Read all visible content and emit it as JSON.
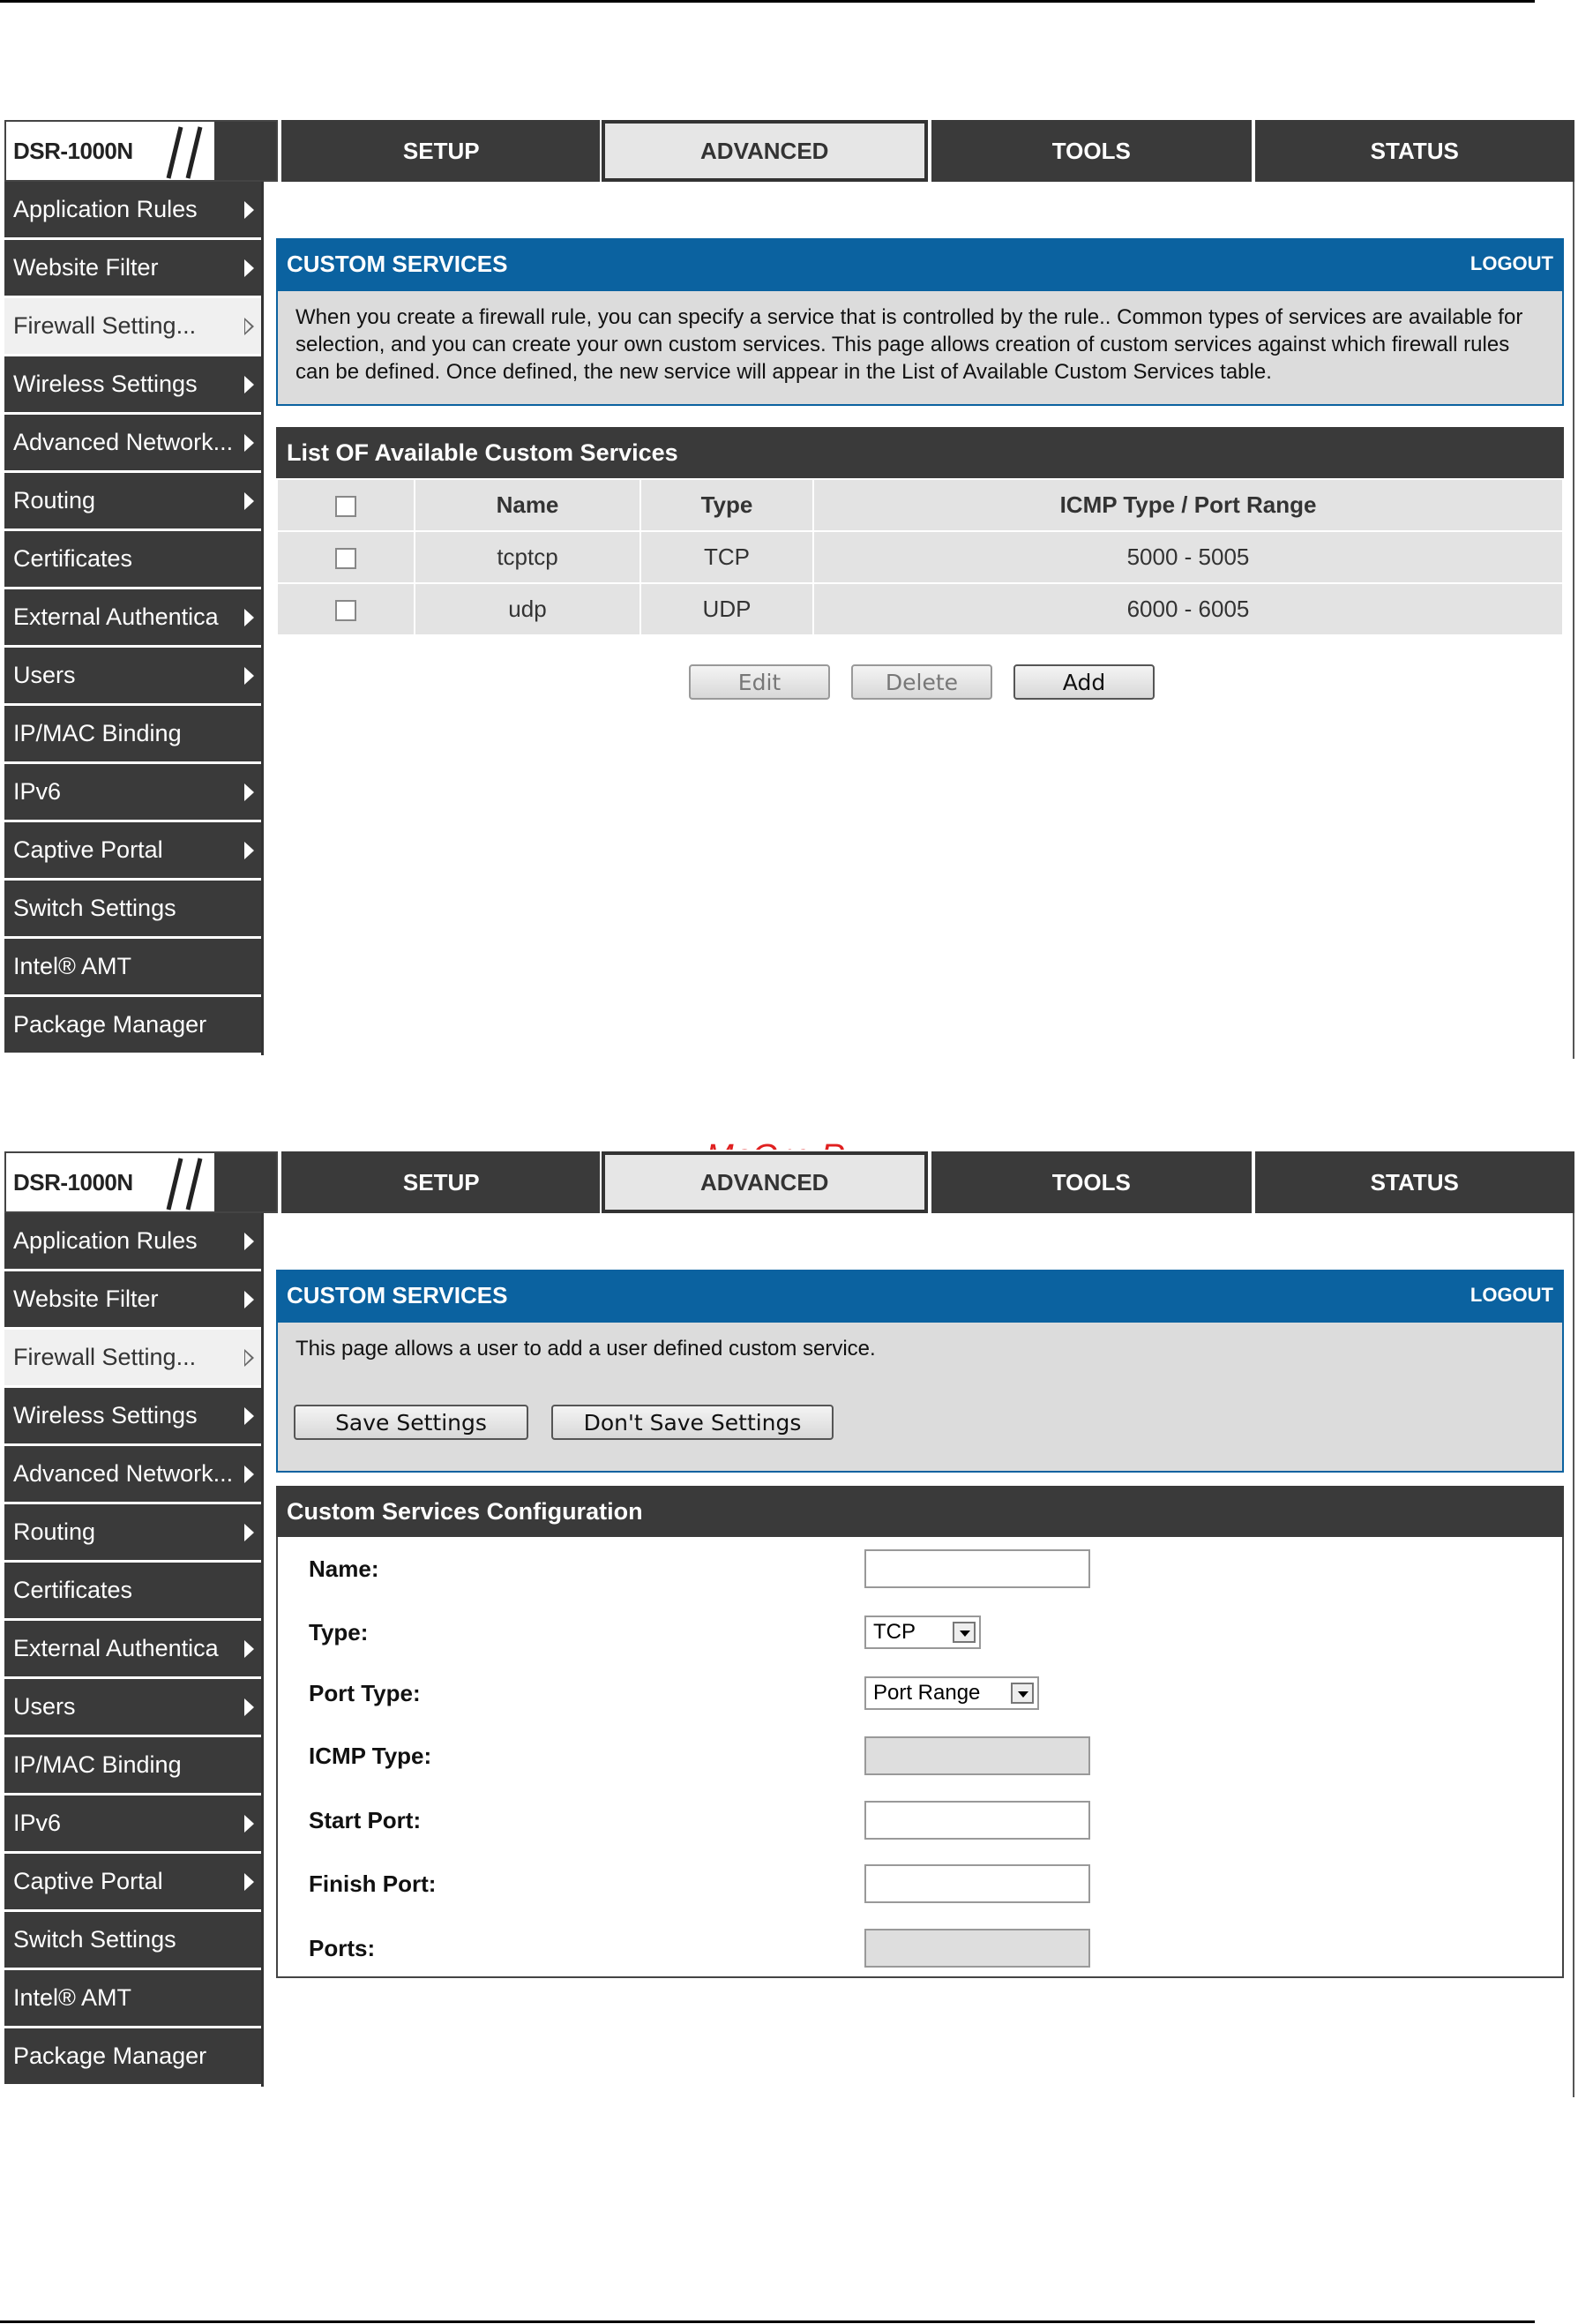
{
  "watermark": "McGrp.Ru",
  "screen1": {
    "brand": "DSR-1000N",
    "tabs": [
      "SETUP",
      "ADVANCED",
      "TOOLS",
      "STATUS"
    ],
    "active_tab": "ADVANCED",
    "sidebar": [
      "Application Rules",
      "Website Filter",
      "Firewall Setting...",
      "Wireless Settings",
      "Advanced Network...",
      "Routing",
      "Certificates",
      "External Authentica",
      "Users",
      "IP/MAC Binding",
      "IPv6",
      "Captive Portal",
      "Switch Settings",
      "Intel® AMT",
      "Package Manager"
    ],
    "panel_title": "CUSTOM SERVICES",
    "logout": "LOGOUT",
    "description": "When you create a firewall rule, you can specify a service that is controlled by the rule.. Common types of services are available for selection, and you can create your own custom services. This page allows creation of custom services against which firewall rules can be defined. Once defined, the new service will appear in the List of Available Custom Services table.",
    "list_title": "List OF Available Custom Services",
    "table": {
      "headers": [
        "Name",
        "Type",
        "ICMP Type / Port Range"
      ],
      "rows": [
        {
          "name": "tcptcp",
          "type": "TCP",
          "range": "5000 - 5005"
        },
        {
          "name": "udp",
          "type": "UDP",
          "range": "6000 - 6005"
        }
      ]
    },
    "buttons": {
      "edit": "Edit",
      "delete": "Delete",
      "add": "Add"
    }
  },
  "screen2": {
    "brand": "DSR-1000N",
    "tabs": [
      "SETUP",
      "ADVANCED",
      "TOOLS",
      "STATUS"
    ],
    "sidebar": [
      "Application Rules",
      "Website Filter",
      "Firewall Setting...",
      "Wireless Settings",
      "Advanced Network...",
      "Routing",
      "Certificates",
      "External Authentica",
      "Users",
      "IP/MAC Binding",
      "IPv6",
      "Captive Portal",
      "Switch Settings",
      "Intel® AMT",
      "Package Manager"
    ],
    "panel_title": "CUSTOM SERVICES",
    "logout": "LOGOUT",
    "description": "This page allows a user to add a user defined custom service.",
    "buttons": {
      "save": "Save Settings",
      "dont_save": "Don't Save Settings"
    },
    "config_title": "Custom Services Configuration",
    "fields": {
      "name": "Name:",
      "type": "Type:",
      "type_value": "TCP",
      "port_type": "Port Type:",
      "port_type_value": "Port Range",
      "icmp_type": "ICMP Type:",
      "start_port": "Start Port:",
      "finish_port": "Finish Port:",
      "ports": "Ports:"
    }
  }
}
